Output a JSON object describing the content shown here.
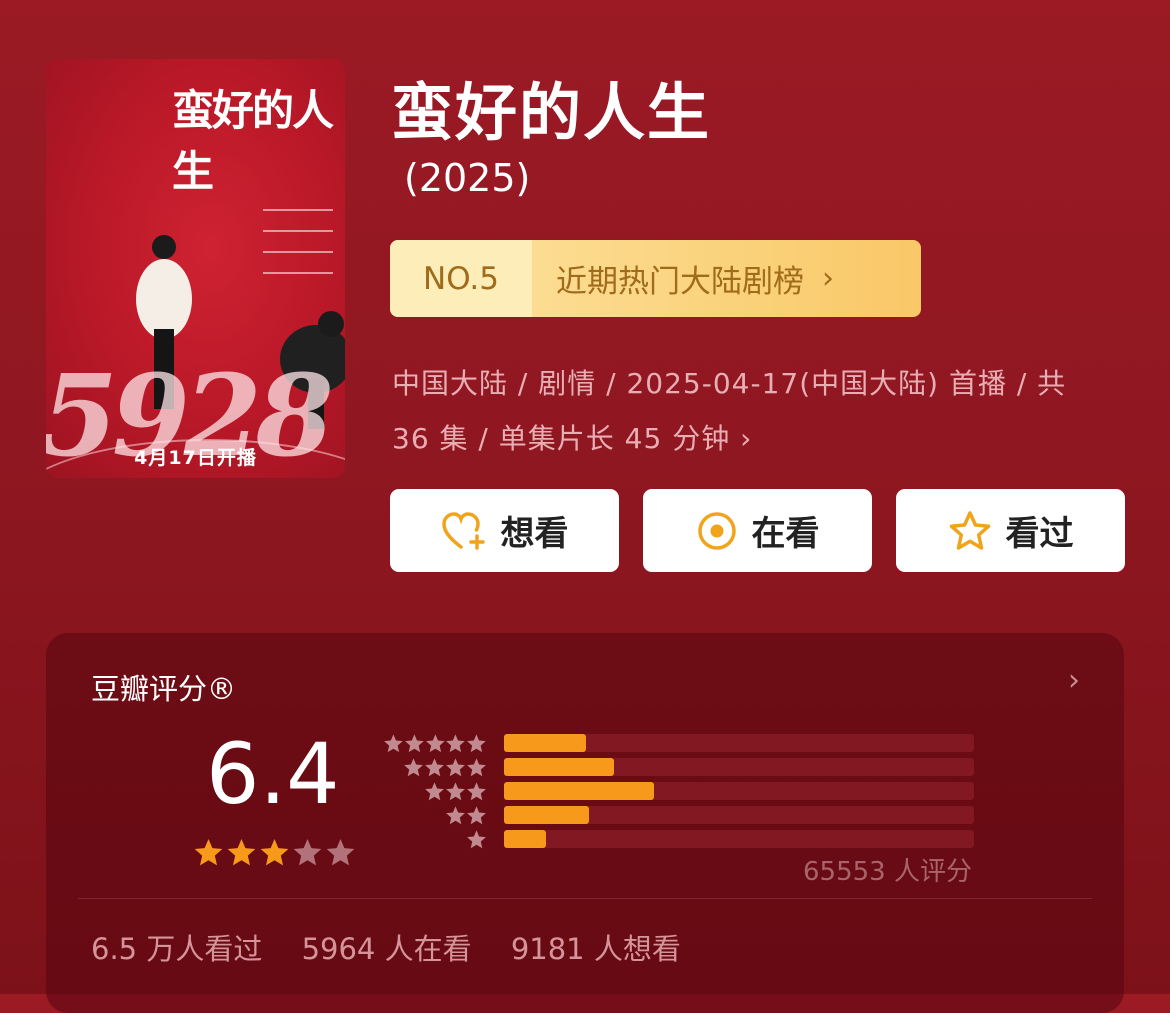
{
  "poster": {
    "title": "蛮好的人生",
    "numbers": "5928",
    "date": "4月17日开播"
  },
  "title": "蛮好的人生",
  "year": "(2025)",
  "rank": {
    "number": "NO.5",
    "label": "近期热门大陆剧榜"
  },
  "meta": {
    "line1": "中国大陆 / 剧情 / 2025-04-17(中国大陆) 首播 / 共",
    "line2": "36 集 / 单集片长 45 分钟"
  },
  "buttons": {
    "want": "想看",
    "watching": "在看",
    "watched": "看过"
  },
  "colors": {
    "accent": "#f79a1b",
    "background": "#9b1a24",
    "rank_text": "#a06b1a"
  },
  "rating": {
    "label": "豆瓣评分®",
    "score": "6.4",
    "stars": 3,
    "count": "65553 人评分",
    "distribution": [
      {
        "stars": 5,
        "percent": 17.5
      },
      {
        "stars": 4,
        "percent": 23.5
      },
      {
        "stars": 3,
        "percent": 32
      },
      {
        "stars": 2,
        "percent": 18
      },
      {
        "stars": 1,
        "percent": 9
      }
    ]
  },
  "stats": {
    "watched": "6.5 万人看过",
    "watching": "5964 人在看",
    "want": "9181 人想看"
  }
}
